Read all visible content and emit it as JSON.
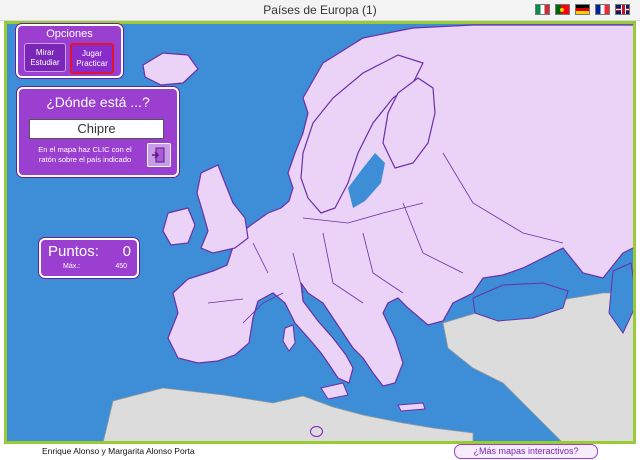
{
  "header": {
    "title": "Países de Europa (1)",
    "languages": [
      {
        "name": "Italiano",
        "icon": "italy-flag-icon"
      },
      {
        "name": "Português",
        "icon": "portugal-flag-icon"
      },
      {
        "name": "Deutsch",
        "icon": "germany-flag-icon"
      },
      {
        "name": "Français",
        "icon": "france-flag-icon"
      },
      {
        "name": "English",
        "icon": "uk-flag-icon"
      }
    ]
  },
  "opciones": {
    "title": "Opciones",
    "mirar_label": "Mirar Estudiar",
    "jugar_label": "Jugar Practicar"
  },
  "pregunta": {
    "title": "¿Dónde está ...?",
    "target": "Chipre",
    "instructions": "En el mapa haz CLIC con el ratón sobre el país indicado",
    "exit_icon": "exit-door-icon"
  },
  "puntos": {
    "label": "Puntos:",
    "value": "0",
    "max_label": "Máx.:",
    "max_value": "450"
  },
  "footer": {
    "authors": "Enrique Alonso y Margarita Alonso Porta",
    "more_maps": "¿Más mapas interactivos?"
  },
  "colors": {
    "sea": "#3d8ed6",
    "land": "#ead3f7",
    "border": "#6b2fa6",
    "outside_land": "#dcdcdc",
    "panel": "#9b3fd1",
    "frame": "#99cc33"
  }
}
